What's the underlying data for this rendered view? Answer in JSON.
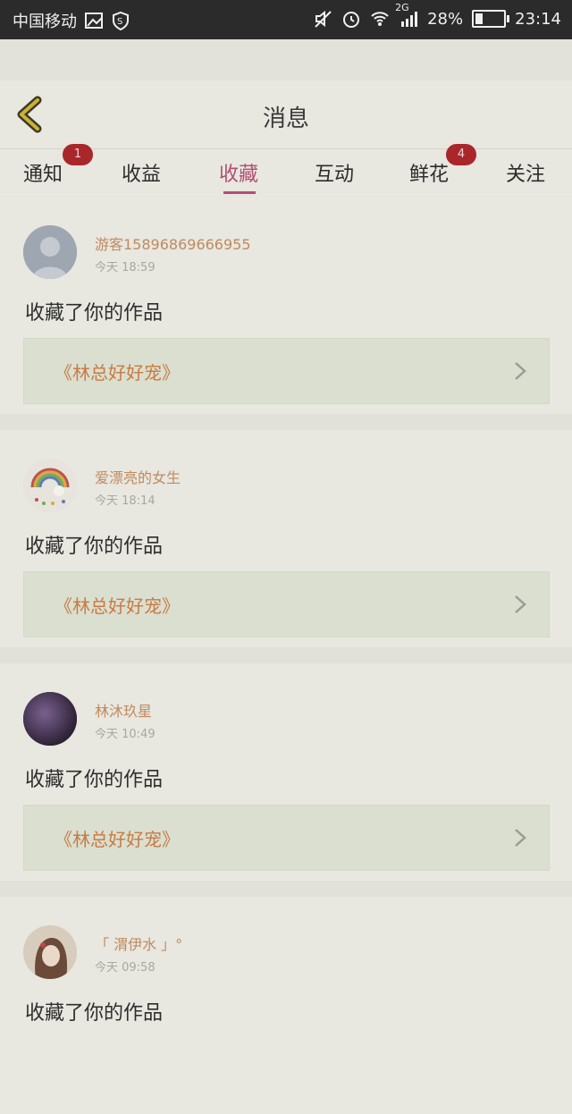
{
  "status_bar": {
    "carrier": "中国移动",
    "network": "2G",
    "battery": "28%",
    "battery_level": 0.28,
    "time": "23:14"
  },
  "header": {
    "title": "消息"
  },
  "tabs": [
    {
      "label": "通知",
      "badge": "1",
      "active": false
    },
    {
      "label": "收益",
      "badge": "",
      "active": false
    },
    {
      "label": "收藏",
      "badge": "",
      "active": true
    },
    {
      "label": "互动",
      "badge": "",
      "active": false
    },
    {
      "label": "鲜花",
      "badge": "4",
      "active": false
    },
    {
      "label": "关注",
      "badge": "",
      "active": false
    }
  ],
  "items": [
    {
      "username": "游客15896869666955",
      "time": "今天 18:59",
      "action": "收藏了你的作品",
      "work": "《林总好好宠》",
      "avatar": "default-avatar"
    },
    {
      "username": "爱漂亮的女生",
      "time": "今天 18:14",
      "action": "收藏了你的作品",
      "work": "《林总好好宠》",
      "avatar": "rainbow-avatar"
    },
    {
      "username": "林沐玖星",
      "time": "今天 10:49",
      "action": "收藏了你的作品",
      "work": "《林总好好宠》",
      "avatar": "dark-purple-avatar"
    },
    {
      "username": "「 渭伊水 」°",
      "time": "今天 09:58",
      "action": "收藏了你的作品",
      "work": "",
      "avatar": "photo-avatar"
    }
  ],
  "colors": {
    "accent": "#b24f73",
    "badge": "#a9262b",
    "username": "#c08a5f",
    "work_title": "#c87a45"
  }
}
